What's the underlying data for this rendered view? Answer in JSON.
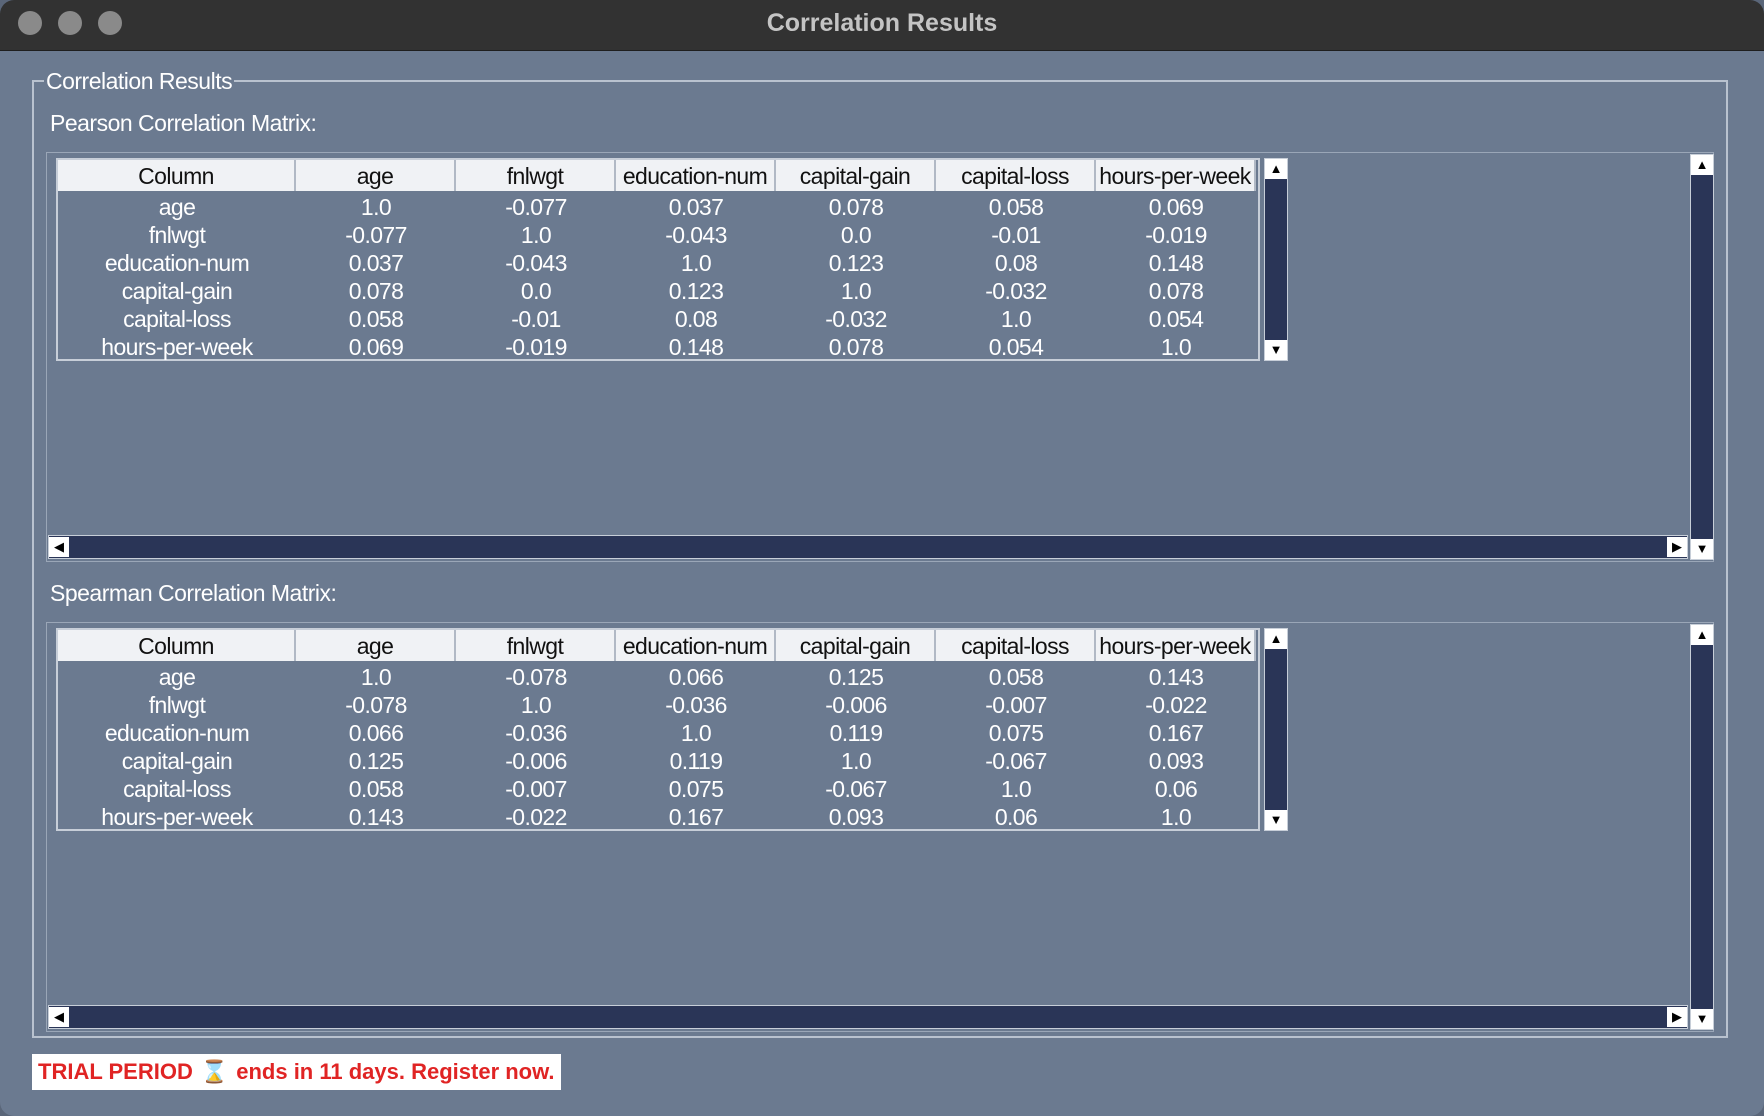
{
  "window": {
    "title": "Correlation Results"
  },
  "panel": {
    "legend": "Correlation Results"
  },
  "columns": [
    "Column",
    "age",
    "fnlwgt",
    "education-num",
    "capital-gain",
    "capital-loss",
    "hours-per-week"
  ],
  "pearson": {
    "label": "Pearson Correlation Matrix:",
    "rows": [
      [
        "age",
        "1.0",
        "-0.077",
        "0.037",
        "0.078",
        "0.058",
        "0.069"
      ],
      [
        "fnlwgt",
        "-0.077",
        "1.0",
        "-0.043",
        "0.0",
        "-0.01",
        "-0.019"
      ],
      [
        "education-num",
        "0.037",
        "-0.043",
        "1.0",
        "0.123",
        "0.08",
        "0.148"
      ],
      [
        "capital-gain",
        "0.078",
        "0.0",
        "0.123",
        "1.0",
        "-0.032",
        "0.078"
      ],
      [
        "capital-loss",
        "0.058",
        "-0.01",
        "0.08",
        "-0.032",
        "1.0",
        "0.054"
      ],
      [
        "hours-per-week",
        "0.069",
        "-0.019",
        "0.148",
        "0.078",
        "0.054",
        "1.0"
      ]
    ]
  },
  "spearman": {
    "label": "Spearman Correlation Matrix:",
    "rows": [
      [
        "age",
        "1.0",
        "-0.078",
        "0.066",
        "0.125",
        "0.058",
        "0.143"
      ],
      [
        "fnlwgt",
        "-0.078",
        "1.0",
        "-0.036",
        "-0.006",
        "-0.007",
        "-0.022"
      ],
      [
        "education-num",
        "0.066",
        "-0.036",
        "1.0",
        "0.119",
        "0.075",
        "0.167"
      ],
      [
        "capital-gain",
        "0.125",
        "-0.006",
        "0.119",
        "1.0",
        "-0.067",
        "0.093"
      ],
      [
        "capital-loss",
        "0.058",
        "-0.007",
        "0.075",
        "-0.067",
        "1.0",
        "0.06"
      ],
      [
        "hours-per-week",
        "0.143",
        "-0.022",
        "0.167",
        "0.093",
        "0.06",
        "1.0"
      ]
    ]
  },
  "trial": {
    "prefix": "TRIAL PERIOD",
    "icon": "hourglass-icon",
    "suffix": "ends in 11 days. Register now."
  },
  "colors": {
    "window_bg": "#6b7a90",
    "titlebar_bg": "#323232",
    "scrollbar_track": "#2a3557",
    "header_bg": "#f0f2f5",
    "trial_text": "#e02424"
  }
}
